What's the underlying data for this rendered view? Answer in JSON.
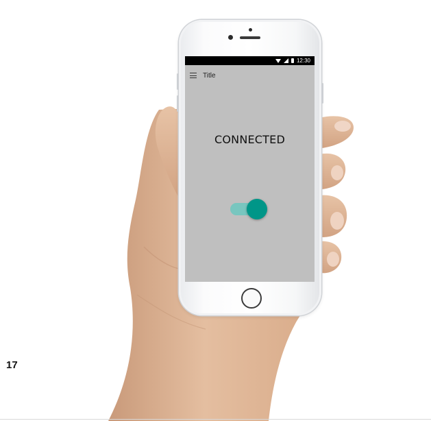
{
  "slide": {
    "number": "17"
  },
  "phone": {
    "status_bar": {
      "time": "12:30",
      "icons": [
        "wifi-icon",
        "signal-icon",
        "battery-icon"
      ]
    },
    "app_bar": {
      "menu_icon": "hamburger-menu-icon",
      "title": "Title"
    },
    "content": {
      "status_text": "CONNECTED",
      "toggle": {
        "state": "on",
        "track_color": "#78c6bf",
        "thumb_color": "#009688"
      }
    },
    "screen_background": "#bfbfbf"
  }
}
